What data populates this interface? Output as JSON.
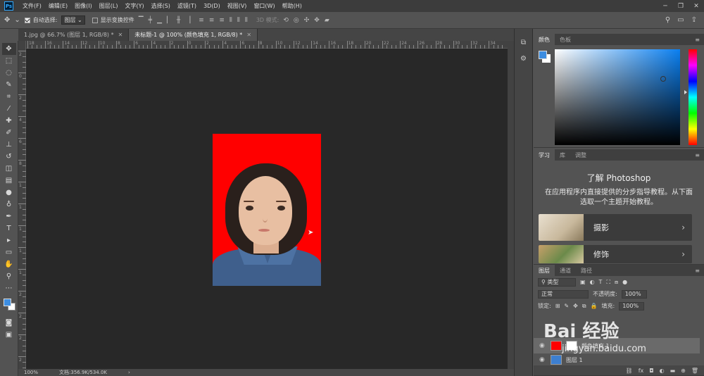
{
  "menubar": {
    "items": [
      "文件(F)",
      "编辑(E)",
      "图像(I)",
      "图层(L)",
      "文字(Y)",
      "选择(S)",
      "滤镜(T)",
      "3D(D)",
      "视图(V)",
      "窗口(W)",
      "帮助(H)"
    ],
    "logo": "Ps"
  },
  "options": {
    "auto_select_label": "自动选择:",
    "auto_select_value": "图层",
    "show_transform_label": "显示变换控件",
    "mode_3d_label": "3D 模式:"
  },
  "tabs": [
    {
      "label": "1.jpg @ 66.7% (图层 1, RGB/8) *",
      "active": false
    },
    {
      "label": "未标题-1 @ 100% (颜色填充 1, RGB/8) *",
      "active": true
    }
  ],
  "ruler": {
    "top_labels": [
      "18",
      "16",
      "14",
      "12",
      "10",
      "8",
      "6",
      "4",
      "2",
      "0",
      "2",
      "4",
      "6",
      "8",
      "10",
      "12",
      "14",
      "16",
      "18",
      "20",
      "22",
      "24",
      "26",
      "28",
      "30",
      "32",
      "34"
    ],
    "left_labels": [
      "2",
      "0",
      "2",
      "4",
      "6",
      "8",
      "1",
      "1",
      "1",
      "1",
      "1",
      "2",
      "2",
      "2",
      "2"
    ]
  },
  "status": {
    "zoom": "100%",
    "doc_info": "文档:356.9K/534.0K"
  },
  "color_panel": {
    "tabs": [
      "颜色",
      "色板"
    ],
    "fg_color": "#3d8de0",
    "bg_color": "#ffffff"
  },
  "learn_panel": {
    "tabs": [
      "学习",
      "库",
      "调整"
    ],
    "title": "了解 Photoshop",
    "description": "在应用程序内直接提供的分步指导教程。从下面选取一个主题开始教程。",
    "cards": [
      "摄影",
      "修饰"
    ]
  },
  "layers_panel": {
    "tabs": [
      "图层",
      "通道",
      "路径"
    ],
    "filter_label": "类型",
    "blend_mode": "正常",
    "opacity_label": "不透明度:",
    "opacity_value": "100%",
    "lock_label": "锁定:",
    "fill_label": "填充:",
    "fill_value": "100%",
    "layers": [
      {
        "name": "颜色填充 1",
        "selected": true,
        "thumb_color": "#ff0000"
      },
      {
        "name": "图层 1",
        "selected": false,
        "thumb_color": "#3d7fd0"
      }
    ]
  },
  "watermark": {
    "main": "Bai 经验",
    "sub": "jingyan.baidu.com"
  }
}
